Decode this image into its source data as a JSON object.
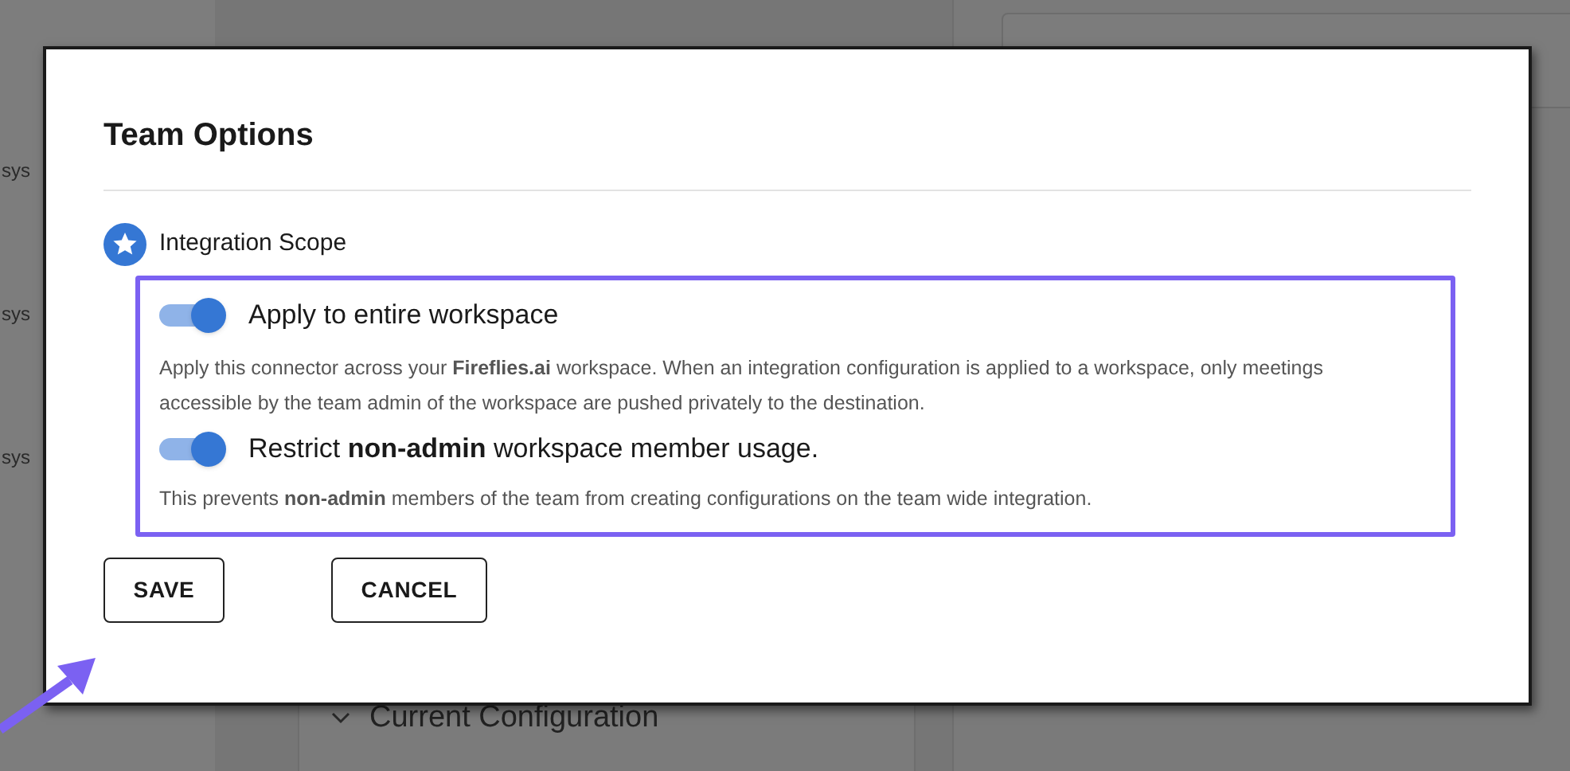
{
  "background": {
    "side_labels": [
      "sys",
      "sys",
      "sys"
    ],
    "section": {
      "title": "Current Configuration",
      "expanded": false
    }
  },
  "dialog": {
    "title": "Team Options",
    "section_title": "Integration Scope",
    "options": [
      {
        "label": "Apply to entire workspace",
        "on": true,
        "description": "Apply this connector across your **Fireflies.ai** workspace. When an integration configuration is applied to a workspace, only meetings accessible by the team admin of the workspace are pushed privately to the destination."
      },
      {
        "label": "Restrict **non-admin** workspace member usage.",
        "on": true,
        "description": "This prevents **non-admin** members of the team from creating configurations on the team wide integration."
      }
    ],
    "buttons": [
      "SAVE",
      "CANCEL"
    ]
  }
}
